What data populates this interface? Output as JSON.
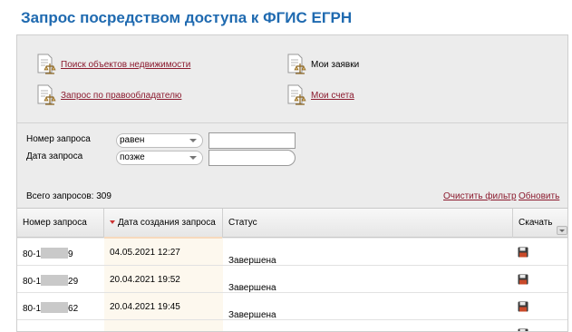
{
  "page": {
    "title": "Запрос посредством доступа к ФГИС ЕГРН"
  },
  "links": [
    {
      "label": "Поиск объектов недвижимости",
      "is_link": true,
      "icon": "document-scales-icon"
    },
    {
      "label": "Мои заявки",
      "is_link": false,
      "icon": "document-scales-icon"
    },
    {
      "label": "Запрос по правообладателю",
      "is_link": true,
      "icon": "document-scales-icon"
    },
    {
      "label": "Мои счета",
      "is_link": true,
      "icon": "document-scales-icon"
    }
  ],
  "filters": {
    "request_number": {
      "label": "Номер запроса",
      "operator": "равен",
      "value": ""
    },
    "request_date": {
      "label": "Дата запроса",
      "operator": "позже",
      "value": ""
    }
  },
  "summary": {
    "total": "Всего запросов: 309"
  },
  "actions": {
    "clear_filter": "Очистить фильтр",
    "refresh": "Обновить"
  },
  "table": {
    "columns": [
      "Номер запроса",
      "Дата создания запроса",
      "Статус",
      "Скачать"
    ],
    "sorted_column": "Дата создания запроса",
    "rows": [
      {
        "number_prefix": "80-1",
        "number_suffix": "9",
        "created": "04.05.2021 12:27",
        "status": "Завершена"
      },
      {
        "number_prefix": "80-1",
        "number_suffix": "29",
        "created": "20.04.2021 19:52",
        "status": "Завершена"
      },
      {
        "number_prefix": "80-1",
        "number_suffix": "62",
        "created": "20.04.2021 19:45",
        "status": "Завершена"
      }
    ]
  },
  "colors": {
    "title": "#1f6ab0",
    "link": "#8b1a2e",
    "sort_arrow": "#cc3333"
  }
}
